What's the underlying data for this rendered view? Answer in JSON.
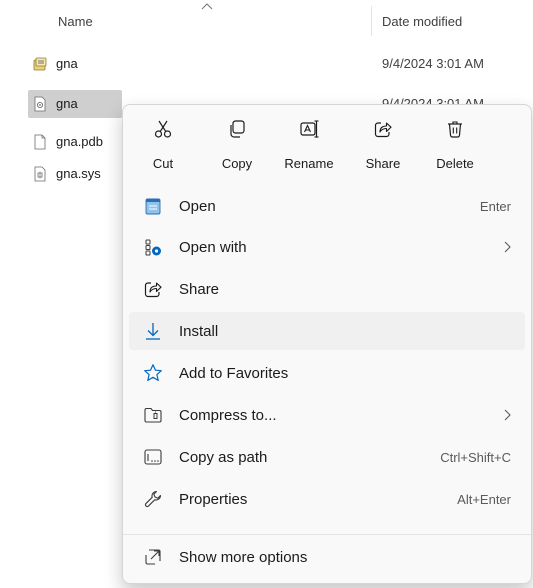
{
  "file_list": {
    "header": {
      "name": "Name",
      "date_modified": "Date modified"
    },
    "files": [
      {
        "name": "gna",
        "date": "9/4/2024 3:01 AM",
        "icon": "setup-information-icon"
      },
      {
        "name": "gna",
        "date": "9/4/2024 3:01 AM",
        "icon": "system-settings-file-icon",
        "selected": true
      },
      {
        "name": "gna.pdb",
        "date": "",
        "icon": "blank-file-icon"
      },
      {
        "name": "gna.sys",
        "date": "",
        "icon": "system-file-icon"
      }
    ]
  },
  "context_menu": {
    "quick_actions": [
      {
        "label": "Cut",
        "icon": "scissors-icon"
      },
      {
        "label": "Copy",
        "icon": "copy-icon"
      },
      {
        "label": "Rename",
        "icon": "rename-icon"
      },
      {
        "label": "Share",
        "icon": "share-icon"
      },
      {
        "label": "Delete",
        "icon": "trash-icon"
      }
    ],
    "items": [
      {
        "label": "Open",
        "shortcut": "Enter",
        "icon": "notepad-icon"
      },
      {
        "label": "Open with",
        "has_submenu": true,
        "icon": "open-with-icon"
      },
      {
        "label": "Share",
        "icon": "share-icon"
      },
      {
        "label": "Install",
        "icon": "download-arrow-icon",
        "hovered": true
      },
      {
        "label": "Add to Favorites",
        "icon": "star-icon"
      },
      {
        "label": "Compress to...",
        "has_submenu": true,
        "icon": "zip-folder-icon"
      },
      {
        "label": "Copy as path",
        "shortcut": "Ctrl+Shift+C",
        "icon": "path-icon"
      },
      {
        "label": "Properties",
        "shortcut": "Alt+Enter",
        "icon": "wrench-icon"
      },
      {
        "label": "Show more options",
        "icon": "expand-icon"
      }
    ]
  },
  "colors": {
    "selected_row": "#cfcfcf",
    "menu_background": "#f9f9f9",
    "hover_item": "#f0f0f0",
    "accent_blue": "#0067c0"
  }
}
